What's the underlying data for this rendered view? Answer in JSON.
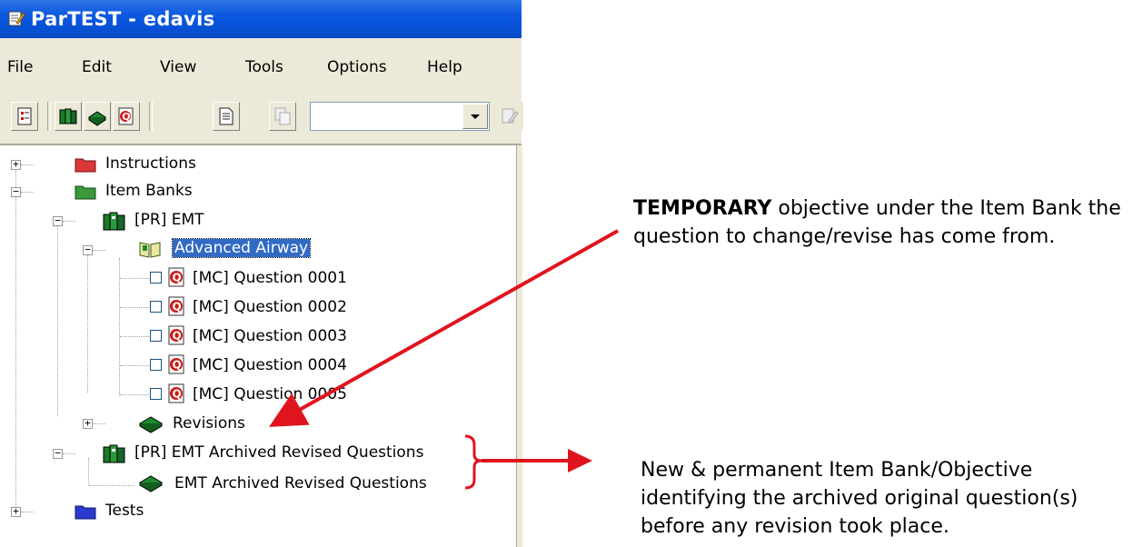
{
  "window": {
    "title": "ParTEST - edavis",
    "menu": [
      "File",
      "Edit",
      "View",
      "Tools",
      "Options",
      "Help"
    ],
    "toolbar_icons": [
      "instructions-icon",
      "item-bank-icon",
      "objective-icon",
      "question-icon",
      "document-icon",
      "copy-icon"
    ],
    "combo_value": ""
  },
  "tree": {
    "instructions": "Instructions",
    "item_banks": "Item Banks",
    "bank_emt": "[PR] EMT",
    "objective_airway": "Advanced Airway",
    "questions": [
      "[MC] Question 0001",
      "[MC] Question 0002",
      "[MC] Question 0003",
      "[MC] Question 0004",
      "[MC] Question 0005"
    ],
    "revisions": "Revisions",
    "bank_archived": "[PR] EMT Archived Revised Questions",
    "objective_archived": "EMT Archived Revised Questions",
    "tests": "Tests"
  },
  "annotations": {
    "temporary_bold": "TEMPORARY",
    "temporary_rest": " objective under the Item Bank the question to change/revise has come from.",
    "permanent": "New & permanent Item Bank/Objective identifying the archived original question(s) before any revision took place."
  },
  "colors": {
    "title_bar": "#0a58de",
    "selection": "#316ac5",
    "annotation_arrow": "#e0141e"
  }
}
